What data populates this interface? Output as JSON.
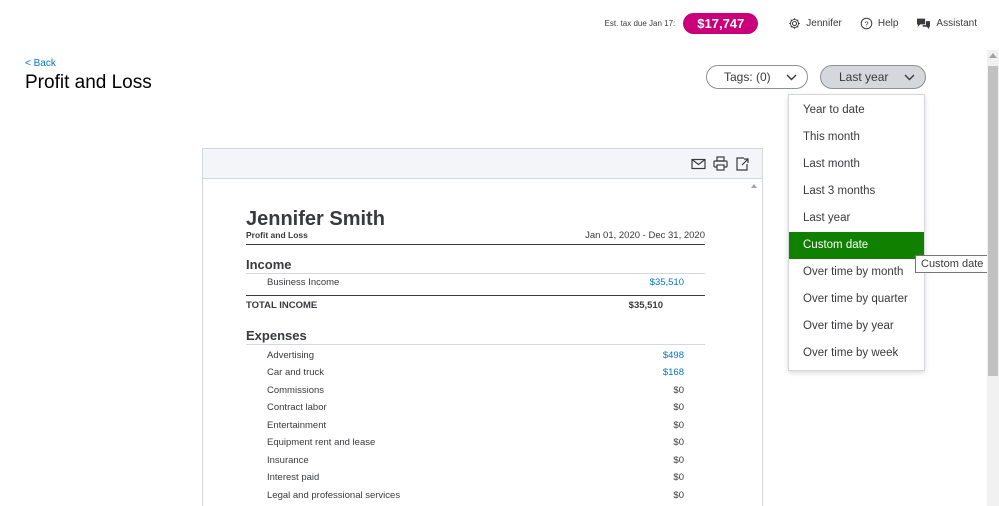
{
  "topbar": {
    "est_tax_label": "Est. tax due Jan 17:",
    "est_tax_value": "$17,747",
    "user_label": "Jennifer",
    "help_label": "Help",
    "assistant_label": "Assistant"
  },
  "header": {
    "back_label": "< Back",
    "title": "Profit and Loss"
  },
  "controls": {
    "tags_label": "Tags: (0)",
    "period_label": "Last year"
  },
  "period_menu": {
    "items": [
      "Year to date",
      "This month",
      "Last month",
      "Last 3 months",
      "Last year",
      "Custom date",
      "Over time by month",
      "Over time by quarter",
      "Over time by year",
      "Over time by week"
    ],
    "selected": "Custom date",
    "tooltip": "Custom date"
  },
  "report": {
    "toolbar_icons": [
      "email-icon",
      "print-icon",
      "export-icon"
    ],
    "company": "Jennifer Smith",
    "report_name": "Profit and Loss",
    "date_range": "Jan 01, 2020 - Dec 31, 2020",
    "income": {
      "title": "Income",
      "rows": [
        {
          "label": "Business Income",
          "amount": "$35,510"
        }
      ],
      "total_label": "TOTAL INCOME",
      "total_amount": "$35,510"
    },
    "expenses": {
      "title": "Expenses",
      "rows": [
        {
          "label": "Advertising",
          "amount": "$498"
        },
        {
          "label": "Car and truck",
          "amount": "$168"
        },
        {
          "label": "Commissions",
          "amount": "$0"
        },
        {
          "label": "Contract labor",
          "amount": "$0"
        },
        {
          "label": "Entertainment",
          "amount": "$0"
        },
        {
          "label": "Equipment rent and lease",
          "amount": "$0"
        },
        {
          "label": "Insurance",
          "amount": "$0"
        },
        {
          "label": "Interest paid",
          "amount": "$0"
        },
        {
          "label": "Legal and professional services",
          "amount": "$0"
        }
      ]
    }
  },
  "colors": {
    "tax_pill": "#c9007a",
    "menu_selected": "#108000",
    "link": "#0077c5"
  }
}
